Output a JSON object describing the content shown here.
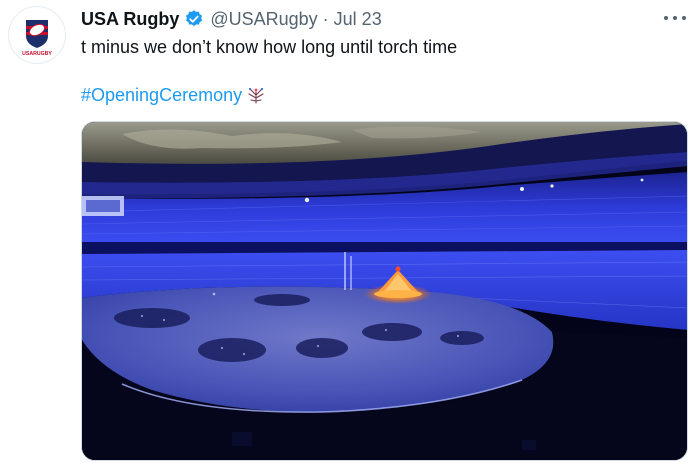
{
  "author": {
    "display_name": "USA Rugby",
    "handle": "@USARugby",
    "separator": "·",
    "date": "Jul 23",
    "avatar_text": "USARUGBY",
    "verified_icon": "verified-badge-icon",
    "verified_color": "#1d9bf0"
  },
  "tweet": {
    "text": "t minus we don’t know how long until torch time",
    "hashtag": "#OpeningCeremony",
    "hashtag_emoji": "olympic-torch-emoji",
    "link_color": "#1d9bf0"
  },
  "media": {
    "image": "stadium-opening-ceremony-photo",
    "dominant_color": "#2a36d8"
  },
  "menu": {
    "icon": "more-options-icon"
  }
}
